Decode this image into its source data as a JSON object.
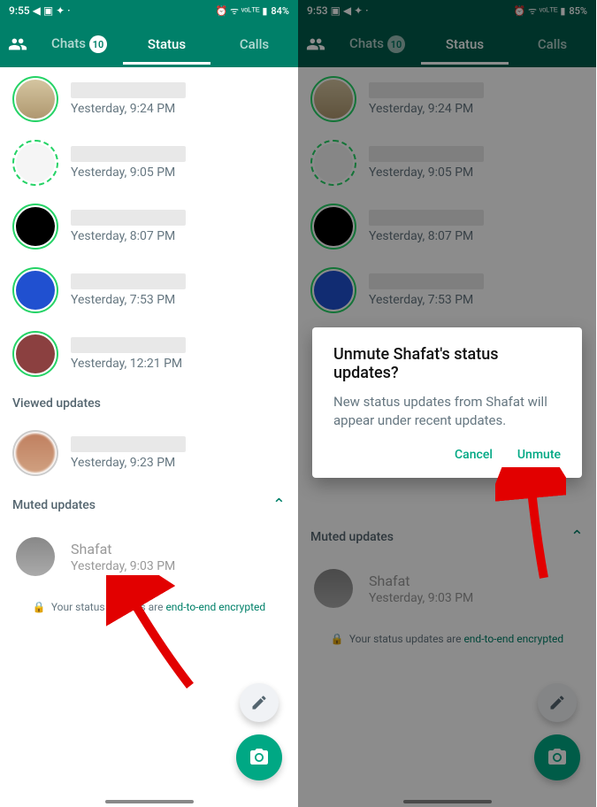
{
  "left": {
    "time": "9:55",
    "status_icons": "◀ ▣ ✦ ·",
    "battery_text": "84%",
    "signal": "⏰ ᯤ ᵛᵒᴸᵀᴱ ▮",
    "tabs": {
      "chats": "Chats",
      "chats_badge": "10",
      "status": "Status",
      "calls": "Calls"
    },
    "items": [
      {
        "time": "Yesterday, 9:24 PM",
        "ring": "solid",
        "av": "bag"
      },
      {
        "time": "Yesterday, 9:05 PM",
        "ring": "dashed",
        "av": "doc"
      },
      {
        "time": "Yesterday, 8:07 PM",
        "ring": "solid",
        "av": "black"
      },
      {
        "time": "Yesterday, 7:53 PM",
        "ring": "solid",
        "av": "blue"
      },
      {
        "time": "Yesterday, 12:21 PM",
        "ring": "solid",
        "av": "brown"
      }
    ],
    "viewed_header": "Viewed updates",
    "viewed": [
      {
        "time": "Yesterday, 9:23 PM",
        "av": "blur1"
      }
    ],
    "muted_header": "Muted updates",
    "muted": [
      {
        "name": "Shafat",
        "time": "Yesterday, 9:03 PM",
        "av": "gray"
      }
    ],
    "e2e_prefix": "Your status updates are ",
    "e2e_link": "end-to-end encrypted"
  },
  "right": {
    "time": "9:53",
    "status_icons": "▣ ◀ ✦ ·",
    "battery_text": "85%",
    "signal": "⏰ ᯤ ᵛᵒᴸᵀᴱ ▮",
    "dialog": {
      "title": "Unmute Shafat's status updates?",
      "body": "New status updates from Shafat will appear under recent updates.",
      "cancel": "Cancel",
      "confirm": "Unmute"
    }
  }
}
